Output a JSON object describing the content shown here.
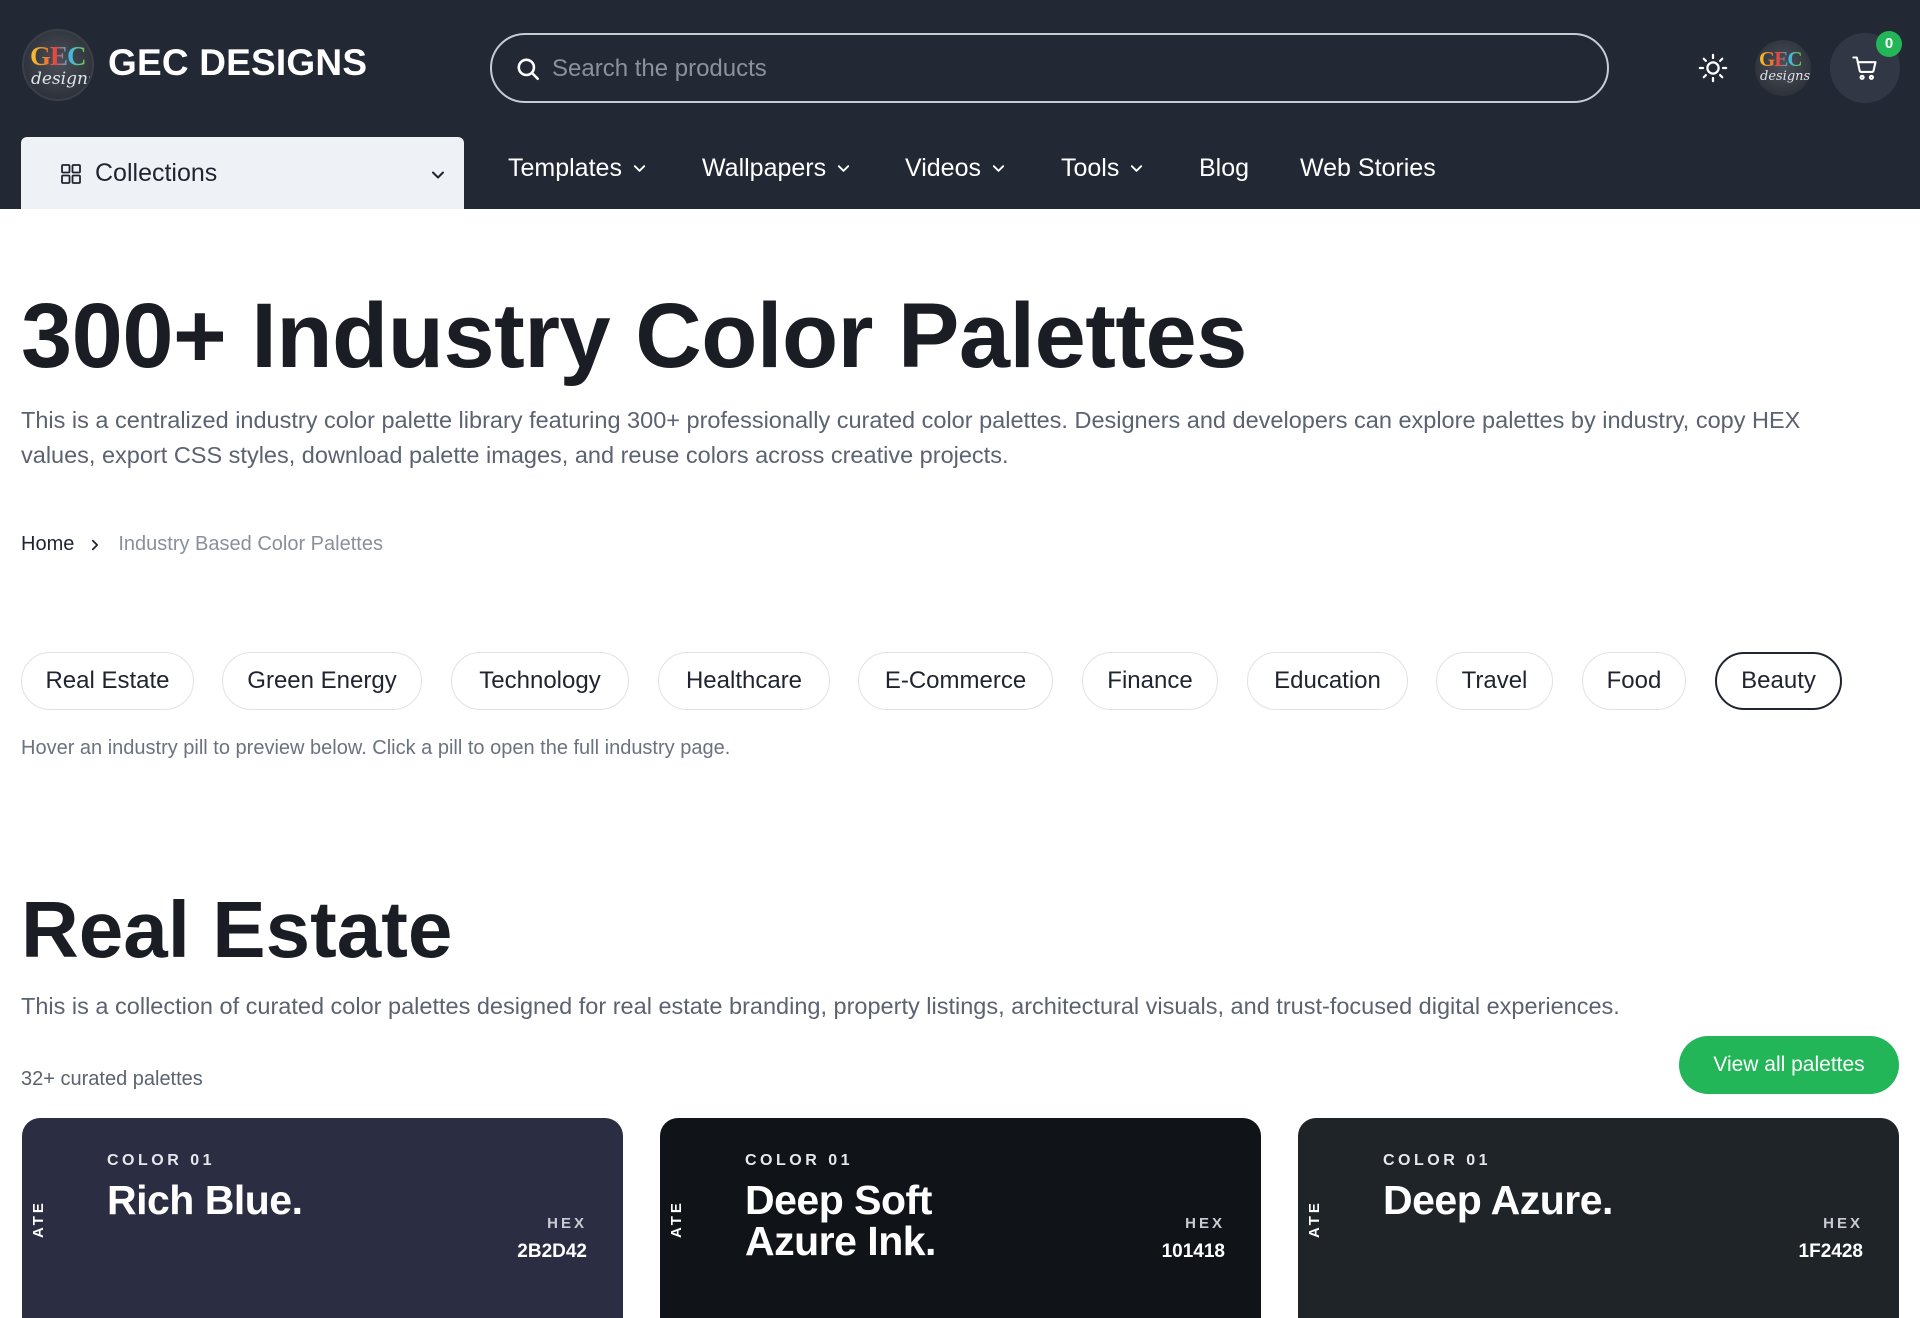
{
  "header": {
    "brand": "GEC DESIGNS",
    "logo_text": "GEC",
    "logo_subtext": "designs",
    "search_placeholder": "Search the products",
    "cart_count": "0"
  },
  "nav": {
    "collections_label": "Collections",
    "items": [
      "Templates",
      "Wallpapers",
      "Videos",
      "Tools",
      "Blog",
      "Web Stories"
    ]
  },
  "page": {
    "title": "300+ Industry Color Palettes",
    "intro": "This is a centralized industry color palette library featuring 300+ professionally curated color palettes. Designers and developers can explore palettes by industry, copy HEX values, export CSS styles, download palette images, and reuse colors across creative projects.",
    "breadcrumb": {
      "home": "Home",
      "current": "Industry Based Color Palettes"
    },
    "pills": [
      "Real Estate",
      "Green Energy",
      "Technology",
      "Healthcare",
      "E-Commerce",
      "Finance",
      "Education",
      "Travel",
      "Food",
      "Beauty"
    ],
    "active_pill": "Beauty",
    "hint": "Hover an industry pill to preview below. Click a pill to open the full industry page."
  },
  "section": {
    "title": "Real Estate",
    "description": "This is a collection of curated color palettes designed for real estate branding, property listings, architectural visuals, and trust-focused digital experiences.",
    "count": "32+ curated palettes",
    "view_all": "View all palettes"
  },
  "cards": [
    {
      "side": "ATE",
      "label": "COLOR 01",
      "name": "Rich Blue.",
      "hex_label": "HEX",
      "hex": "2B2D42",
      "bg": "#2B2D42"
    },
    {
      "side": "ATE",
      "label": "COLOR 01",
      "name": "Deep Soft Azure Ink.",
      "hex_label": "HEX",
      "hex": "101418",
      "bg": "#101418"
    },
    {
      "side": "ATE",
      "label": "COLOR 01",
      "name": "Deep Azure.",
      "hex_label": "HEX",
      "hex": "1F2428",
      "bg": "#1F2428"
    }
  ],
  "colors": {
    "header_bg": "#222834",
    "accent_green": "#22b658",
    "text_dark": "#1a1d23",
    "text_muted": "#5b6270"
  },
  "icons": [
    "search-icon",
    "sun-icon",
    "cart-icon",
    "grid-icon",
    "chevron-down-icon",
    "chevron-right-icon"
  ]
}
